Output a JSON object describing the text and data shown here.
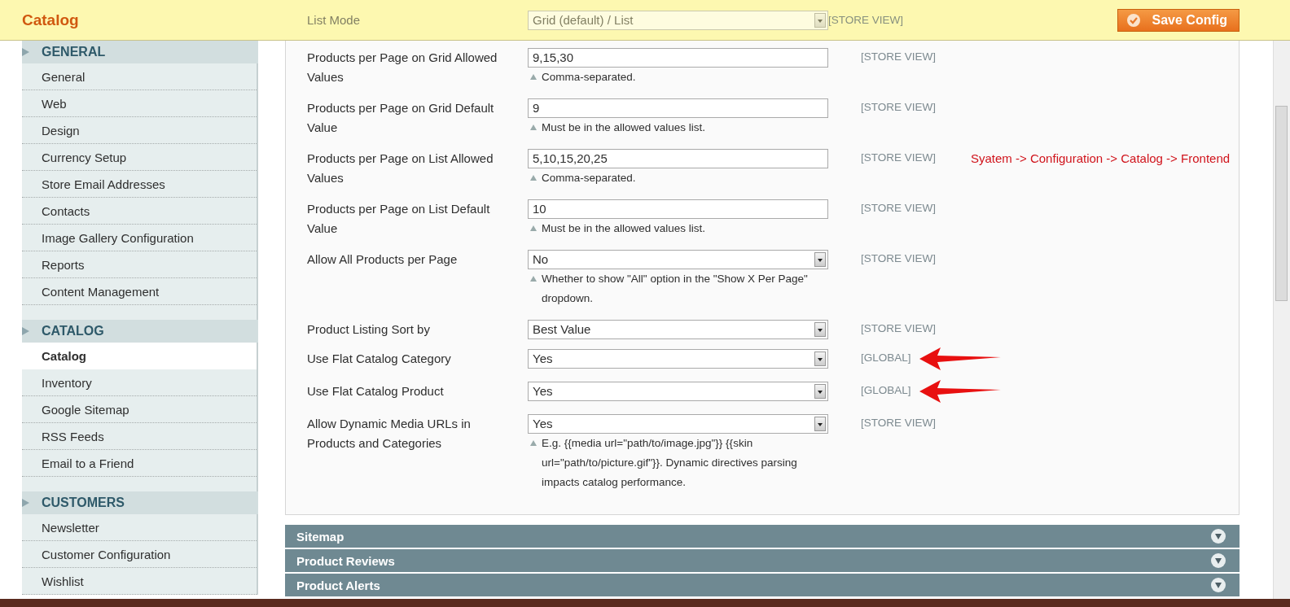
{
  "header": {
    "title": "Catalog",
    "faded_row": {
      "label": "List Mode",
      "value": "Grid (default) / List",
      "scope": "[STORE VIEW]"
    },
    "save_button": "Save Config"
  },
  "sidebar": {
    "sections": [
      {
        "title": "GENERAL",
        "items": [
          {
            "label": "General",
            "selected": false
          },
          {
            "label": "Web",
            "selected": false
          },
          {
            "label": "Design",
            "selected": false
          },
          {
            "label": "Currency Setup",
            "selected": false
          },
          {
            "label": "Store Email Addresses",
            "selected": false
          },
          {
            "label": "Contacts",
            "selected": false
          },
          {
            "label": "Image Gallery Configuration",
            "selected": false
          },
          {
            "label": "Reports",
            "selected": false
          },
          {
            "label": "Content Management",
            "selected": false
          }
        ]
      },
      {
        "title": "CATALOG",
        "items": [
          {
            "label": "Catalog",
            "selected": true
          },
          {
            "label": "Inventory",
            "selected": false
          },
          {
            "label": "Google Sitemap",
            "selected": false
          },
          {
            "label": "RSS Feeds",
            "selected": false
          },
          {
            "label": "Email to a Friend",
            "selected": false
          }
        ]
      },
      {
        "title": "CUSTOMERS",
        "items": [
          {
            "label": "Newsletter",
            "selected": false
          },
          {
            "label": "Customer Configuration",
            "selected": false
          },
          {
            "label": "Wishlist",
            "selected": false
          }
        ]
      }
    ]
  },
  "form": {
    "rows": [
      {
        "label": "Products per Page on Grid Allowed Values",
        "kind": "text",
        "value": "9,15,30",
        "note": "Comma-separated.",
        "scope": "[STORE VIEW]",
        "arrow": false
      },
      {
        "label": "Products per Page on Grid Default Value",
        "kind": "text",
        "value": "9",
        "note": "Must be in the allowed values list.",
        "scope": "[STORE VIEW]",
        "arrow": false
      },
      {
        "label": "Products per Page on List Allowed Values",
        "kind": "text",
        "value": "5,10,15,20,25",
        "note": "Comma-separated.",
        "scope": "[STORE VIEW]",
        "arrow": false
      },
      {
        "label": "Products per Page on List Default Value",
        "kind": "text",
        "value": "10",
        "note": "Must be in the allowed values list.",
        "scope": "[STORE VIEW]",
        "arrow": false
      },
      {
        "label": "Allow All Products per Page",
        "kind": "select",
        "value": "No",
        "note": "Whether to show \"All\" option in the \"Show X Per Page\" dropdown.",
        "scope": "[STORE VIEW]",
        "arrow": false
      },
      {
        "label": "Product Listing Sort by",
        "kind": "select",
        "value": "Best Value",
        "scope": "[STORE VIEW]",
        "arrow": false
      },
      {
        "label": "Use Flat Catalog Category",
        "kind": "select",
        "value": "Yes",
        "scope": "[GLOBAL]",
        "arrow": true
      },
      {
        "label": "Use Flat Catalog Product",
        "kind": "select",
        "value": "Yes",
        "scope": "[GLOBAL]",
        "arrow": true
      },
      {
        "label": "Allow Dynamic Media URLs in Products and Categories",
        "kind": "select",
        "value": "Yes",
        "note": "E.g. {{media url=\"path/to/image.jpg\"}} {{skin url=\"path/to/picture.gif\"}}. Dynamic directives parsing impacts catalog performance.",
        "scope": "[STORE VIEW]",
        "arrow": false
      }
    ],
    "annotation": "Syatem -> Configuration -> Catalog -> Frontend"
  },
  "collapsed_sections": [
    "Sitemap",
    "Product Reviews",
    "Product Alerts"
  ]
}
